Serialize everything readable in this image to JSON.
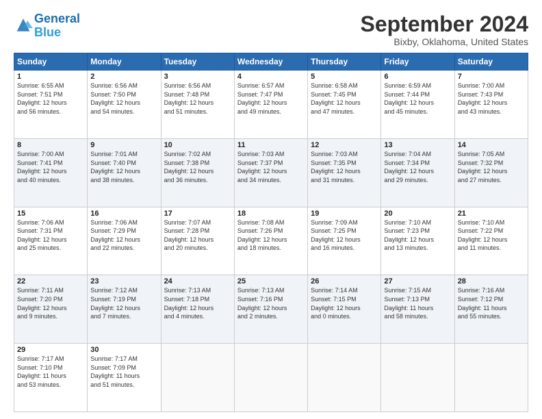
{
  "logo": {
    "line1": "General",
    "line2": "Blue"
  },
  "title": "September 2024",
  "subtitle": "Bixby, Oklahoma, United States",
  "days_of_week": [
    "Sunday",
    "Monday",
    "Tuesday",
    "Wednesday",
    "Thursday",
    "Friday",
    "Saturday"
  ],
  "weeks": [
    [
      {
        "day": 1,
        "info": "Sunrise: 6:55 AM\nSunset: 7:51 PM\nDaylight: 12 hours\nand 56 minutes."
      },
      {
        "day": 2,
        "info": "Sunrise: 6:56 AM\nSunset: 7:50 PM\nDaylight: 12 hours\nand 54 minutes."
      },
      {
        "day": 3,
        "info": "Sunrise: 6:56 AM\nSunset: 7:48 PM\nDaylight: 12 hours\nand 51 minutes."
      },
      {
        "day": 4,
        "info": "Sunrise: 6:57 AM\nSunset: 7:47 PM\nDaylight: 12 hours\nand 49 minutes."
      },
      {
        "day": 5,
        "info": "Sunrise: 6:58 AM\nSunset: 7:45 PM\nDaylight: 12 hours\nand 47 minutes."
      },
      {
        "day": 6,
        "info": "Sunrise: 6:59 AM\nSunset: 7:44 PM\nDaylight: 12 hours\nand 45 minutes."
      },
      {
        "day": 7,
        "info": "Sunrise: 7:00 AM\nSunset: 7:43 PM\nDaylight: 12 hours\nand 43 minutes."
      }
    ],
    [
      {
        "day": 8,
        "info": "Sunrise: 7:00 AM\nSunset: 7:41 PM\nDaylight: 12 hours\nand 40 minutes."
      },
      {
        "day": 9,
        "info": "Sunrise: 7:01 AM\nSunset: 7:40 PM\nDaylight: 12 hours\nand 38 minutes."
      },
      {
        "day": 10,
        "info": "Sunrise: 7:02 AM\nSunset: 7:38 PM\nDaylight: 12 hours\nand 36 minutes."
      },
      {
        "day": 11,
        "info": "Sunrise: 7:03 AM\nSunset: 7:37 PM\nDaylight: 12 hours\nand 34 minutes."
      },
      {
        "day": 12,
        "info": "Sunrise: 7:03 AM\nSunset: 7:35 PM\nDaylight: 12 hours\nand 31 minutes."
      },
      {
        "day": 13,
        "info": "Sunrise: 7:04 AM\nSunset: 7:34 PM\nDaylight: 12 hours\nand 29 minutes."
      },
      {
        "day": 14,
        "info": "Sunrise: 7:05 AM\nSunset: 7:32 PM\nDaylight: 12 hours\nand 27 minutes."
      }
    ],
    [
      {
        "day": 15,
        "info": "Sunrise: 7:06 AM\nSunset: 7:31 PM\nDaylight: 12 hours\nand 25 minutes."
      },
      {
        "day": 16,
        "info": "Sunrise: 7:06 AM\nSunset: 7:29 PM\nDaylight: 12 hours\nand 22 minutes."
      },
      {
        "day": 17,
        "info": "Sunrise: 7:07 AM\nSunset: 7:28 PM\nDaylight: 12 hours\nand 20 minutes."
      },
      {
        "day": 18,
        "info": "Sunrise: 7:08 AM\nSunset: 7:26 PM\nDaylight: 12 hours\nand 18 minutes."
      },
      {
        "day": 19,
        "info": "Sunrise: 7:09 AM\nSunset: 7:25 PM\nDaylight: 12 hours\nand 16 minutes."
      },
      {
        "day": 20,
        "info": "Sunrise: 7:10 AM\nSunset: 7:23 PM\nDaylight: 12 hours\nand 13 minutes."
      },
      {
        "day": 21,
        "info": "Sunrise: 7:10 AM\nSunset: 7:22 PM\nDaylight: 12 hours\nand 11 minutes."
      }
    ],
    [
      {
        "day": 22,
        "info": "Sunrise: 7:11 AM\nSunset: 7:20 PM\nDaylight: 12 hours\nand 9 minutes."
      },
      {
        "day": 23,
        "info": "Sunrise: 7:12 AM\nSunset: 7:19 PM\nDaylight: 12 hours\nand 7 minutes."
      },
      {
        "day": 24,
        "info": "Sunrise: 7:13 AM\nSunset: 7:18 PM\nDaylight: 12 hours\nand 4 minutes."
      },
      {
        "day": 25,
        "info": "Sunrise: 7:13 AM\nSunset: 7:16 PM\nDaylight: 12 hours\nand 2 minutes."
      },
      {
        "day": 26,
        "info": "Sunrise: 7:14 AM\nSunset: 7:15 PM\nDaylight: 12 hours\nand 0 minutes."
      },
      {
        "day": 27,
        "info": "Sunrise: 7:15 AM\nSunset: 7:13 PM\nDaylight: 11 hours\nand 58 minutes."
      },
      {
        "day": 28,
        "info": "Sunrise: 7:16 AM\nSunset: 7:12 PM\nDaylight: 11 hours\nand 55 minutes."
      }
    ],
    [
      {
        "day": 29,
        "info": "Sunrise: 7:17 AM\nSunset: 7:10 PM\nDaylight: 11 hours\nand 53 minutes."
      },
      {
        "day": 30,
        "info": "Sunrise: 7:17 AM\nSunset: 7:09 PM\nDaylight: 11 hours\nand 51 minutes."
      },
      null,
      null,
      null,
      null,
      null
    ]
  ]
}
